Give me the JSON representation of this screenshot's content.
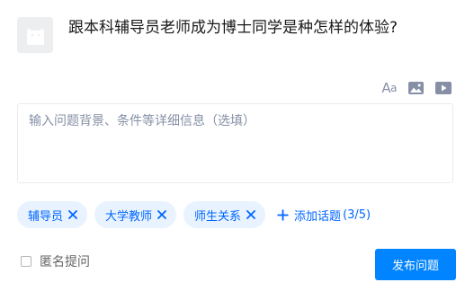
{
  "question": {
    "title": "跟本科辅导员老师成为博士同学是种怎样的体验?"
  },
  "toolbar": {
    "font_icon_label_big": "A",
    "font_icon_label_small": "a",
    "icons": [
      "font-size-icon",
      "image-icon",
      "video-icon"
    ]
  },
  "detail": {
    "placeholder": "输入问题背景、条件等详细信息（选填）",
    "value": ""
  },
  "tags": {
    "items": [
      {
        "label": "辅导员"
      },
      {
        "label": "大学教师"
      },
      {
        "label": "师生关系"
      }
    ],
    "add_label": "添加话题",
    "count_text": "(3/5)"
  },
  "footer": {
    "anonymous_label": "匿名提问",
    "anonymous_checked": false,
    "publish_label": "发布问题"
  },
  "colors": {
    "accent": "#0084ff",
    "tag_bg": "#e8f3ff",
    "tag_text": "#0066ff",
    "muted": "#8590a6"
  }
}
